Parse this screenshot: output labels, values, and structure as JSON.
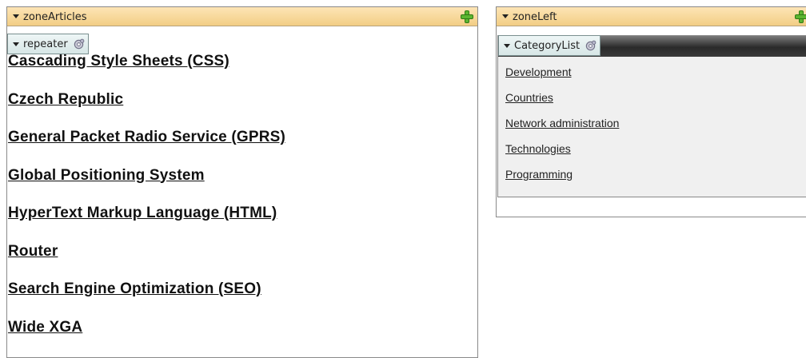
{
  "zone_articles": {
    "title": "zoneArticles",
    "webpart": {
      "label": "repeater"
    },
    "articles": [
      "Cascading Style Sheets (CSS)",
      "Czech Republic",
      "General Packet Radio Service (GPRS)",
      "Global Positioning System",
      "HyperText Markup Language (HTML)",
      "Router",
      "Search Engine Optimization (SEO)",
      "Wide XGA"
    ]
  },
  "zone_left": {
    "title": "zoneLeft",
    "webpart": {
      "label": "CategoryList"
    },
    "categories": [
      "Development",
      "Countries",
      "Network administration",
      "Technologies",
      "Programming"
    ]
  },
  "colors": {
    "zone_header": "#f2cd85",
    "webpart_tag": "#d7e6e6",
    "add_icon": "#5cb531",
    "category_bar": "#2a2a2a"
  },
  "icons": [
    "collapse-arrow-icon",
    "add-webpart-icon",
    "webpart-properties-icon"
  ]
}
